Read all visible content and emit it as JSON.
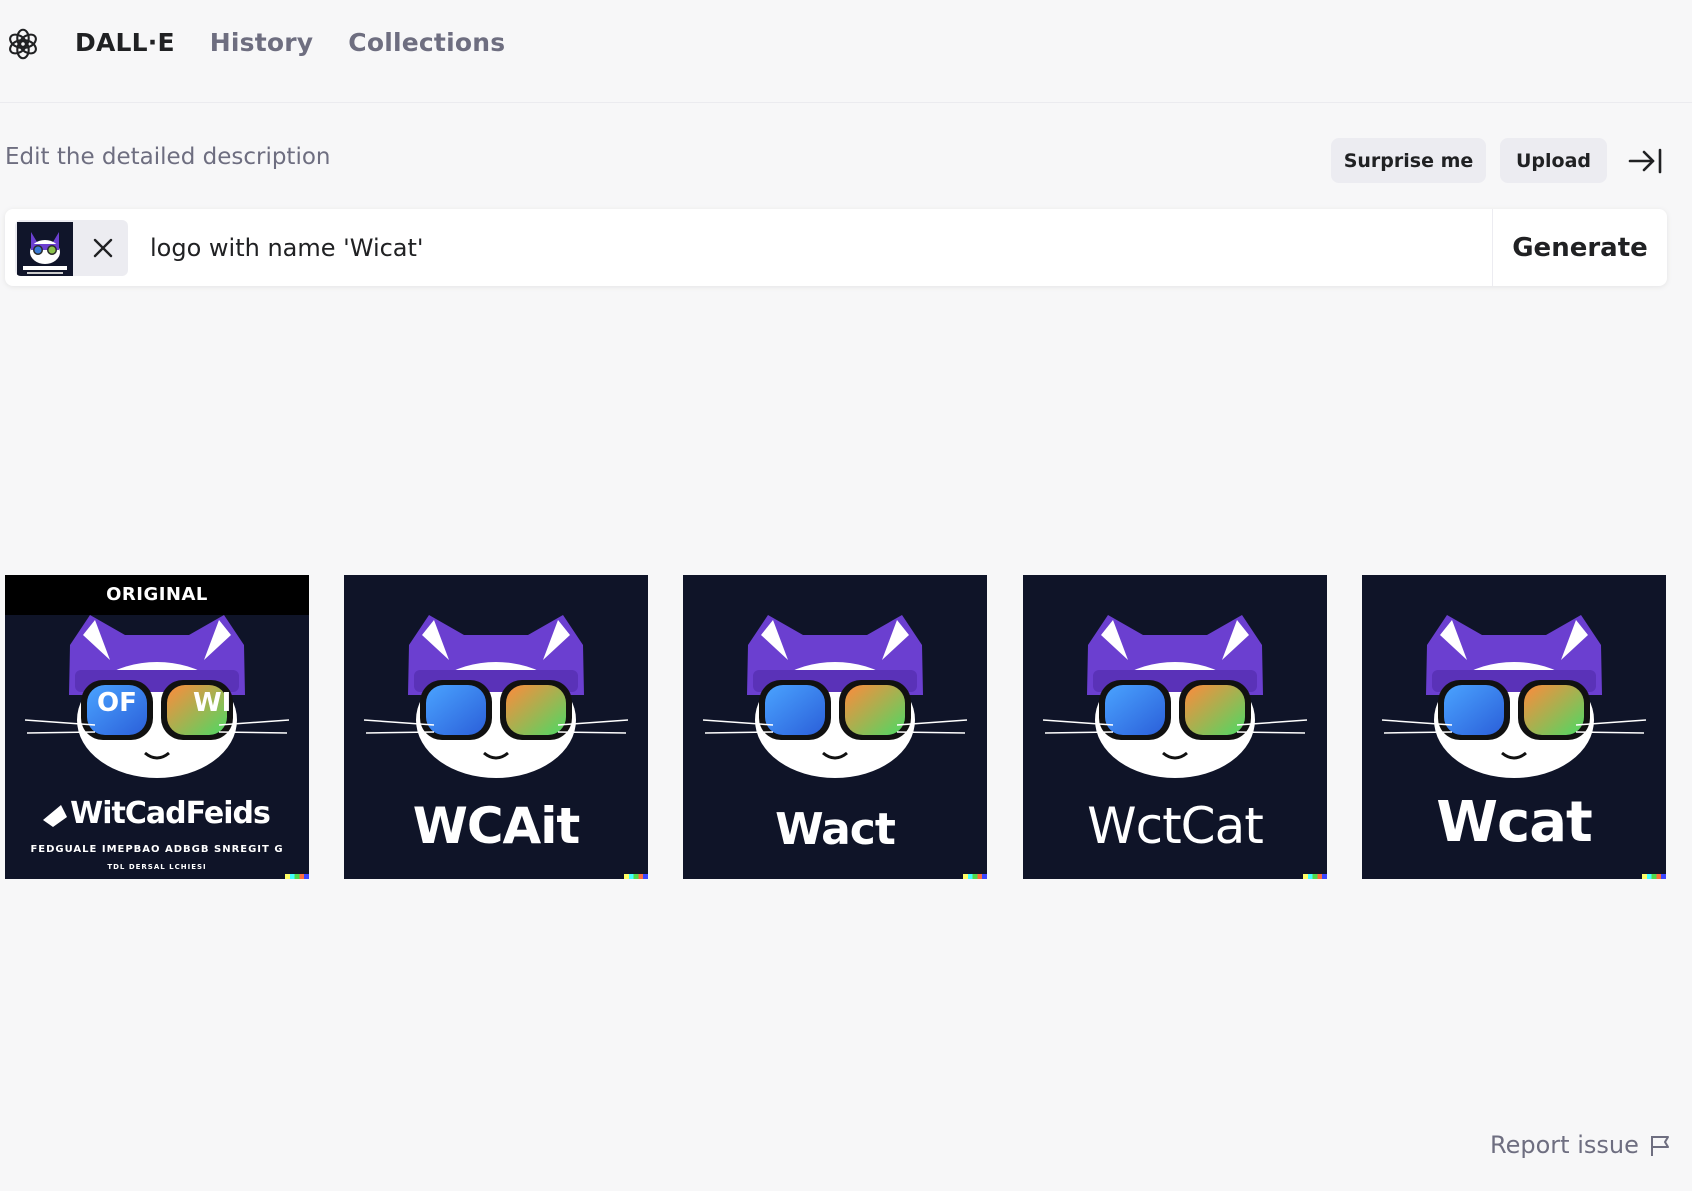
{
  "header": {
    "logo_name": "openai-logo",
    "nav": [
      {
        "label": "DALL·E",
        "active": true
      },
      {
        "label": "History",
        "active": false
      },
      {
        "label": "Collections",
        "active": false
      }
    ]
  },
  "prompt": {
    "label": "Edit the detailed description",
    "surprise_label": "Surprise me",
    "upload_label": "Upload",
    "input_value": "logo with name 'Wicat'",
    "generate_label": "Generate"
  },
  "results": {
    "original_badge": "ORIGINAL",
    "images": [
      {
        "title": "WitCadFeids",
        "subtitle": "FEDGUALE IMEPBAO ADBGB SNREGIT G",
        "subtitle2": "TDL DERSAL LCHIESI",
        "lens_left": "OF",
        "lens_right": "WI"
      },
      {
        "title": "WCAit"
      },
      {
        "title": "Wact"
      },
      {
        "title": "WctCat"
      },
      {
        "title": "Wcat"
      }
    ]
  },
  "footer": {
    "report_label": "Report issue"
  },
  "colors": {
    "background": "#f7f7f8",
    "tile_bg": "#0f1428",
    "cat_purple": "#6b3fd0",
    "text_dark": "#202123",
    "text_muted": "#6e6e80"
  }
}
